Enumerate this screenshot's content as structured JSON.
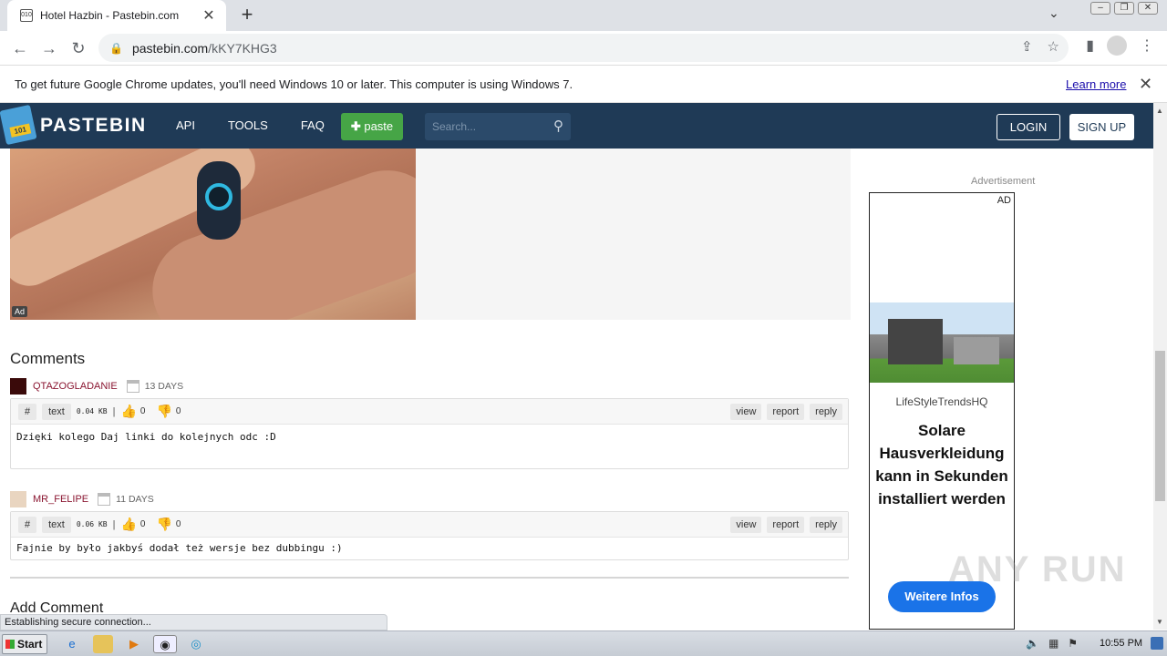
{
  "browser": {
    "tab_title": "Hotel Hazbin - Pastebin.com",
    "favicon_text": "010",
    "url_host": "pastebin.com",
    "url_path": "/kKY7KHG3"
  },
  "infobar": {
    "message": "To get future Google Chrome updates, you'll need Windows 10 or later. This computer is using Windows 7.",
    "learn_more": "Learn more"
  },
  "header": {
    "logo_text": "PASTEBIN",
    "logo_badge": "101",
    "nav": [
      "API",
      "TOOLS",
      "FAQ"
    ],
    "paste_label": "paste",
    "search_placeholder": "Search...",
    "login": "LOGIN",
    "signup": "SIGN UP"
  },
  "ad": {
    "badge": "Ad"
  },
  "comments": {
    "title": "Comments",
    "items": [
      {
        "user": "QTAZOGLADANIE",
        "age": "13 DAYS",
        "hash": "#",
        "format": "text",
        "size": "0.04 KB",
        "likes": "0",
        "dislikes": "0",
        "text": "Dzięki kolego Daj linki do kolejnych odc :D",
        "avatar_color": "#3a0a0a"
      },
      {
        "user": "MR_FELIPE",
        "age": "11 DAYS",
        "hash": "#",
        "format": "text",
        "size": "0.06 KB",
        "likes": "0",
        "dislikes": "0",
        "text": "Fajnie by było jakbyś dodał też wersje bez dubbingu :)",
        "avatar_color": "#e9d5c0"
      }
    ],
    "actions": {
      "view": "view",
      "report": "report",
      "reply": "reply"
    },
    "add_comment": "Add Comment"
  },
  "side_ad": {
    "label": "Advertisement",
    "tag": "AD",
    "brand": "LifeStyleTrendsHQ",
    "headline": "Solare Hausverkleidung kann in Sekunden installiert werden",
    "cta": "Weitere Infos"
  },
  "watermark": "ANY RUN",
  "statusbar": "Establishing secure connection...",
  "taskbar": {
    "start": "Start",
    "clock": "10:55 PM"
  }
}
